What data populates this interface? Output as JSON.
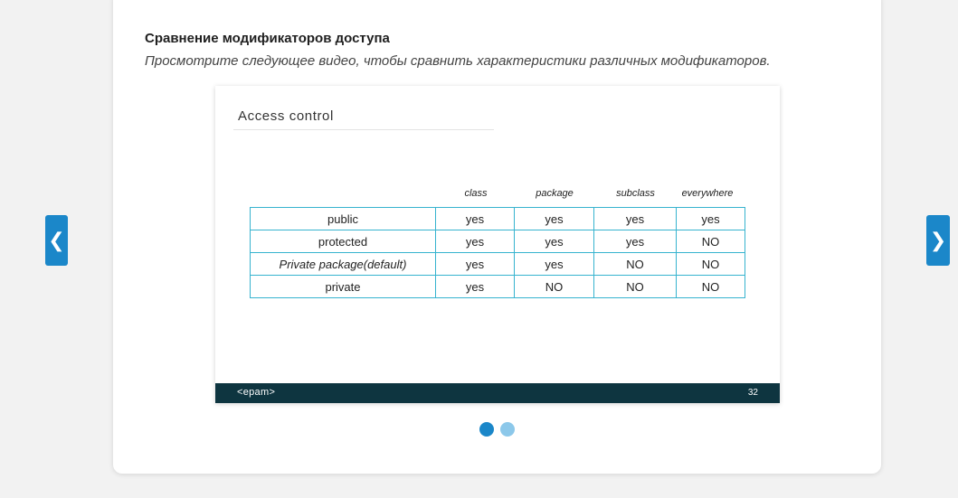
{
  "header": {
    "title": "Сравнение модификаторов доступа",
    "subtitle": "Просмотрите следующее видео, чтобы сравнить характеристики различных модификаторов."
  },
  "slide": {
    "title": "Access control",
    "column_headers": [
      "class",
      "package",
      "subclass",
      "everywhere"
    ],
    "rows": [
      {
        "modifier": "public",
        "cells": [
          "yes",
          "yes",
          "yes",
          "yes"
        ]
      },
      {
        "modifier": "protected",
        "cells": [
          "yes",
          "yes",
          "yes",
          "NO"
        ]
      },
      {
        "modifier": "Private package(default)",
        "cells": [
          "yes",
          "yes",
          "NO",
          "NO"
        ]
      },
      {
        "modifier": "private",
        "cells": [
          "yes",
          "NO",
          "NO",
          "NO"
        ]
      }
    ],
    "footer": {
      "logo": "<epam>",
      "page_number": "32"
    }
  },
  "navigation": {
    "prev_icon": "chevron-left-icon",
    "next_icon": "chevron-right-icon",
    "prev_glyph": "❮",
    "next_glyph": "❯"
  },
  "pagination": {
    "total": 2,
    "current": 1
  },
  "colors": {
    "accent": "#1b87c9",
    "table_border": "#36b3cf",
    "slide_footer": "#0e3540",
    "dot_active": "#1b87c9",
    "dot_inactive": "#8cc8ea"
  }
}
